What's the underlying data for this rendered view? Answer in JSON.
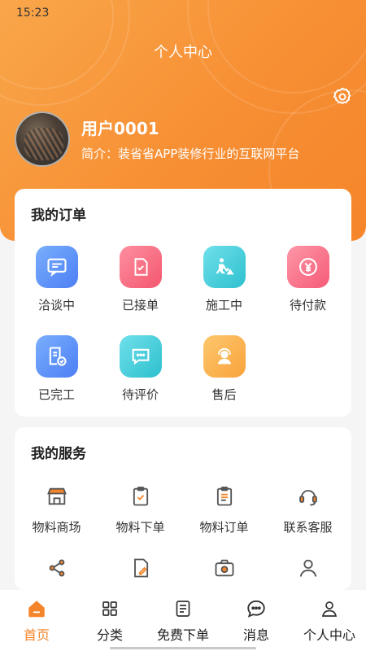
{
  "status_bar": {
    "time": "15:23"
  },
  "header": {
    "title": "个人中心",
    "settings_icon": "gear-icon"
  },
  "profile": {
    "username": "用户0001",
    "intro": "简介：装省省APP装修行业的互联网平台"
  },
  "orders": {
    "title": "我的订单",
    "items": [
      {
        "label": "洽谈中",
        "icon": "chat-icon",
        "color": "#5b8ff9"
      },
      {
        "label": "已接单",
        "icon": "document-check-icon",
        "color": "#f7677d"
      },
      {
        "label": "施工中",
        "icon": "construction-worker-icon",
        "color": "#3fc9d6"
      },
      {
        "label": "待付款",
        "icon": "yen-coin-icon",
        "color": "#fb6e86"
      },
      {
        "label": "已完工",
        "icon": "document-done-icon",
        "color": "#5b8ff9"
      },
      {
        "label": "待评价",
        "icon": "comment-icon",
        "color": "#3fc9d6"
      },
      {
        "label": "售后",
        "icon": "customer-service-icon",
        "color": "#fbb04c"
      }
    ]
  },
  "services": {
    "title": "我的服务",
    "items": [
      {
        "label": "物料商场",
        "icon": "store-icon"
      },
      {
        "label": "物料下单",
        "icon": "clipboard-check-icon"
      },
      {
        "label": "物料订单",
        "icon": "order-list-icon"
      },
      {
        "label": "联系客服",
        "icon": "headset-icon"
      },
      {
        "label": "",
        "icon": "share-icon"
      },
      {
        "label": "",
        "icon": "edit-document-icon"
      },
      {
        "label": "",
        "icon": "camera-icon"
      },
      {
        "label": "",
        "icon": "user-icon"
      }
    ]
  },
  "tabbar": {
    "accent": "#f5852a",
    "tabs": [
      {
        "label": "首页",
        "icon": "home-icon",
        "active": true
      },
      {
        "label": "分类",
        "icon": "grid-icon",
        "active": false
      },
      {
        "label": "免费下单",
        "icon": "form-icon",
        "active": false
      },
      {
        "label": "消息",
        "icon": "message-icon",
        "active": false
      },
      {
        "label": "个人中心",
        "icon": "person-icon",
        "active": false
      }
    ]
  }
}
